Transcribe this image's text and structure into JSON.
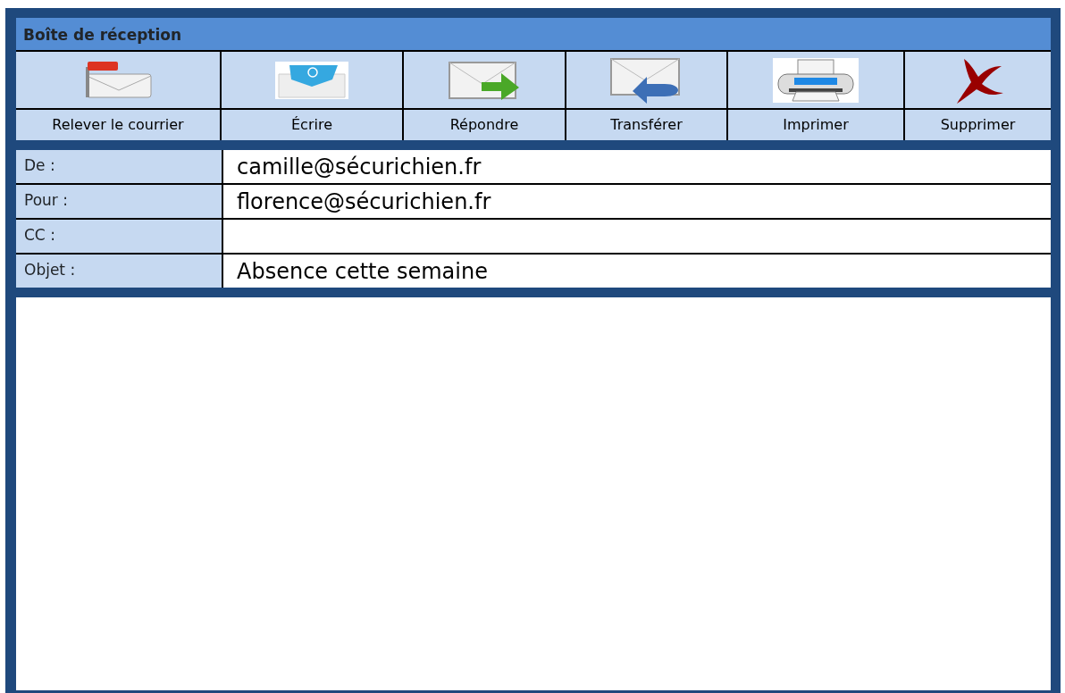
{
  "window": {
    "title": "Boîte de réception"
  },
  "toolbar": [
    {
      "kind": "get-mail",
      "label": "Relever le courrier"
    },
    {
      "kind": "compose",
      "label": "Écrire"
    },
    {
      "kind": "reply",
      "label": "Répondre"
    },
    {
      "kind": "forward",
      "label": "Transférer"
    },
    {
      "kind": "print",
      "label": "Imprimer"
    },
    {
      "kind": "delete",
      "label": "Supprimer"
    }
  ],
  "fields": [
    {
      "label": "De :",
      "value": "camille@sécurichien.fr"
    },
    {
      "label": "Pour :",
      "value": "florence@sécurichien.fr"
    },
    {
      "label": "CC :"
    },
    {
      "label": "Objet :",
      "value": "Absence cette semaine"
    }
  ]
}
